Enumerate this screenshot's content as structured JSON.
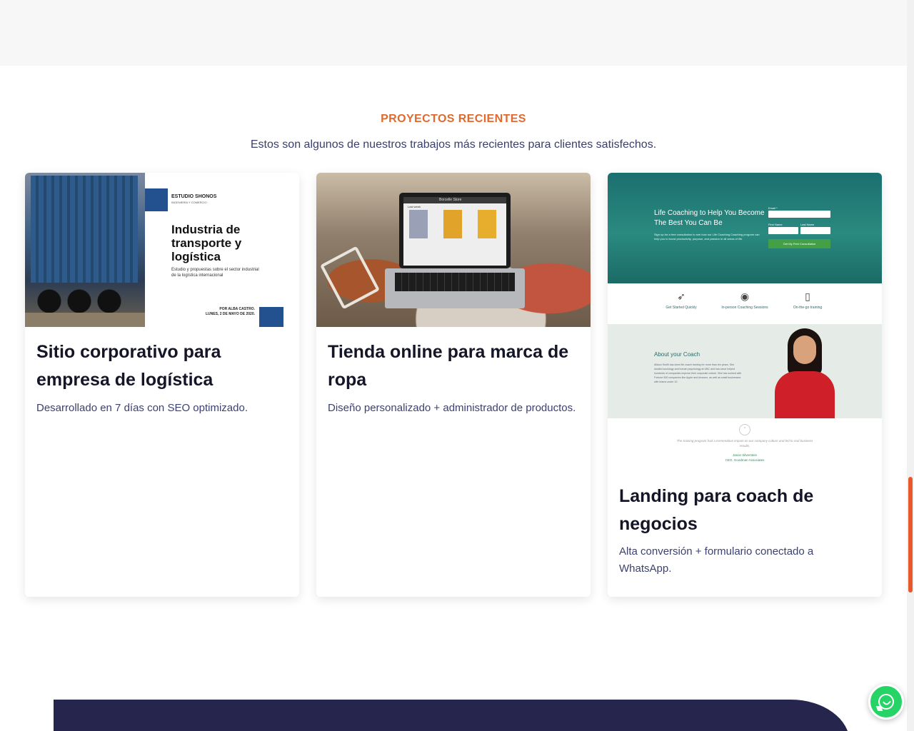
{
  "section": {
    "eyebrow": "PROYECTOS RECIENTES",
    "subtitle": "Estos son algunos de nuestros trabajos más recientes para clientes satisfechos."
  },
  "projects": [
    {
      "title": "Sitio corporativo para empresa de logística",
      "description": "Desarrollado en 7 días con SEO optimizado.",
      "thumbnail": {
        "studio": "ESTUDIO SHONOS",
        "studio_sub": "INGENIERÍA Y COMERCIO",
        "doc_title": "Industria de transporte y logística",
        "doc_sub": "Estudio y propuestas sobre el sector industrial de la logística internacional",
        "author": "POR ALBA CASTRO.",
        "date": "LUNES, 2 DE MAYO DE 2020."
      }
    },
    {
      "title": "Tienda online para marca de ropa",
      "description": "Diseño personalizado + administrador de productos.",
      "thumbnail": {
        "store": "Borcelle Store",
        "heading": "Last week"
      }
    },
    {
      "title": "Landing para coach de negocios",
      "description": "Alta conversión + formulario conectado a WhatsApp.",
      "thumbnail": {
        "hero_title": "Life Coaching to Help You Become The Best You Can Be",
        "hero_text": "Sign up for a free consultation to see how our Life Coaching Coaching program can help you to boost productivity, purpose, and passion in all areas of life.",
        "email_label": "Email *",
        "first_name_label": "First Name",
        "last_name_label": "Last Name",
        "cta": "Get My Free Consultation",
        "features": [
          "Get Started Quickly",
          "In-person Coaching Sessions",
          "On-the-go training"
        ],
        "about_title": "About your Coach",
        "about_text": "Allison Smith has done life coach training for more than ten years. She studied sociology and human psychology at UBC and has since helped hundreds of companies improve their corporate culture. She has worked with Fortune 500 companies like Apple and Amazon, as well as small businesses with teams under 10.",
        "quote": "The training program had a tremendous impact on our company culture and led to real business results.",
        "quote_author": "Jason Silverstein",
        "quote_role": "CEO, Goodman Associates"
      }
    }
  ],
  "whatsapp": {
    "icon": "whatsapp-icon"
  },
  "colors": {
    "accent": "#e2692d",
    "navy": "#26254d",
    "whatsapp": "#25d366"
  }
}
